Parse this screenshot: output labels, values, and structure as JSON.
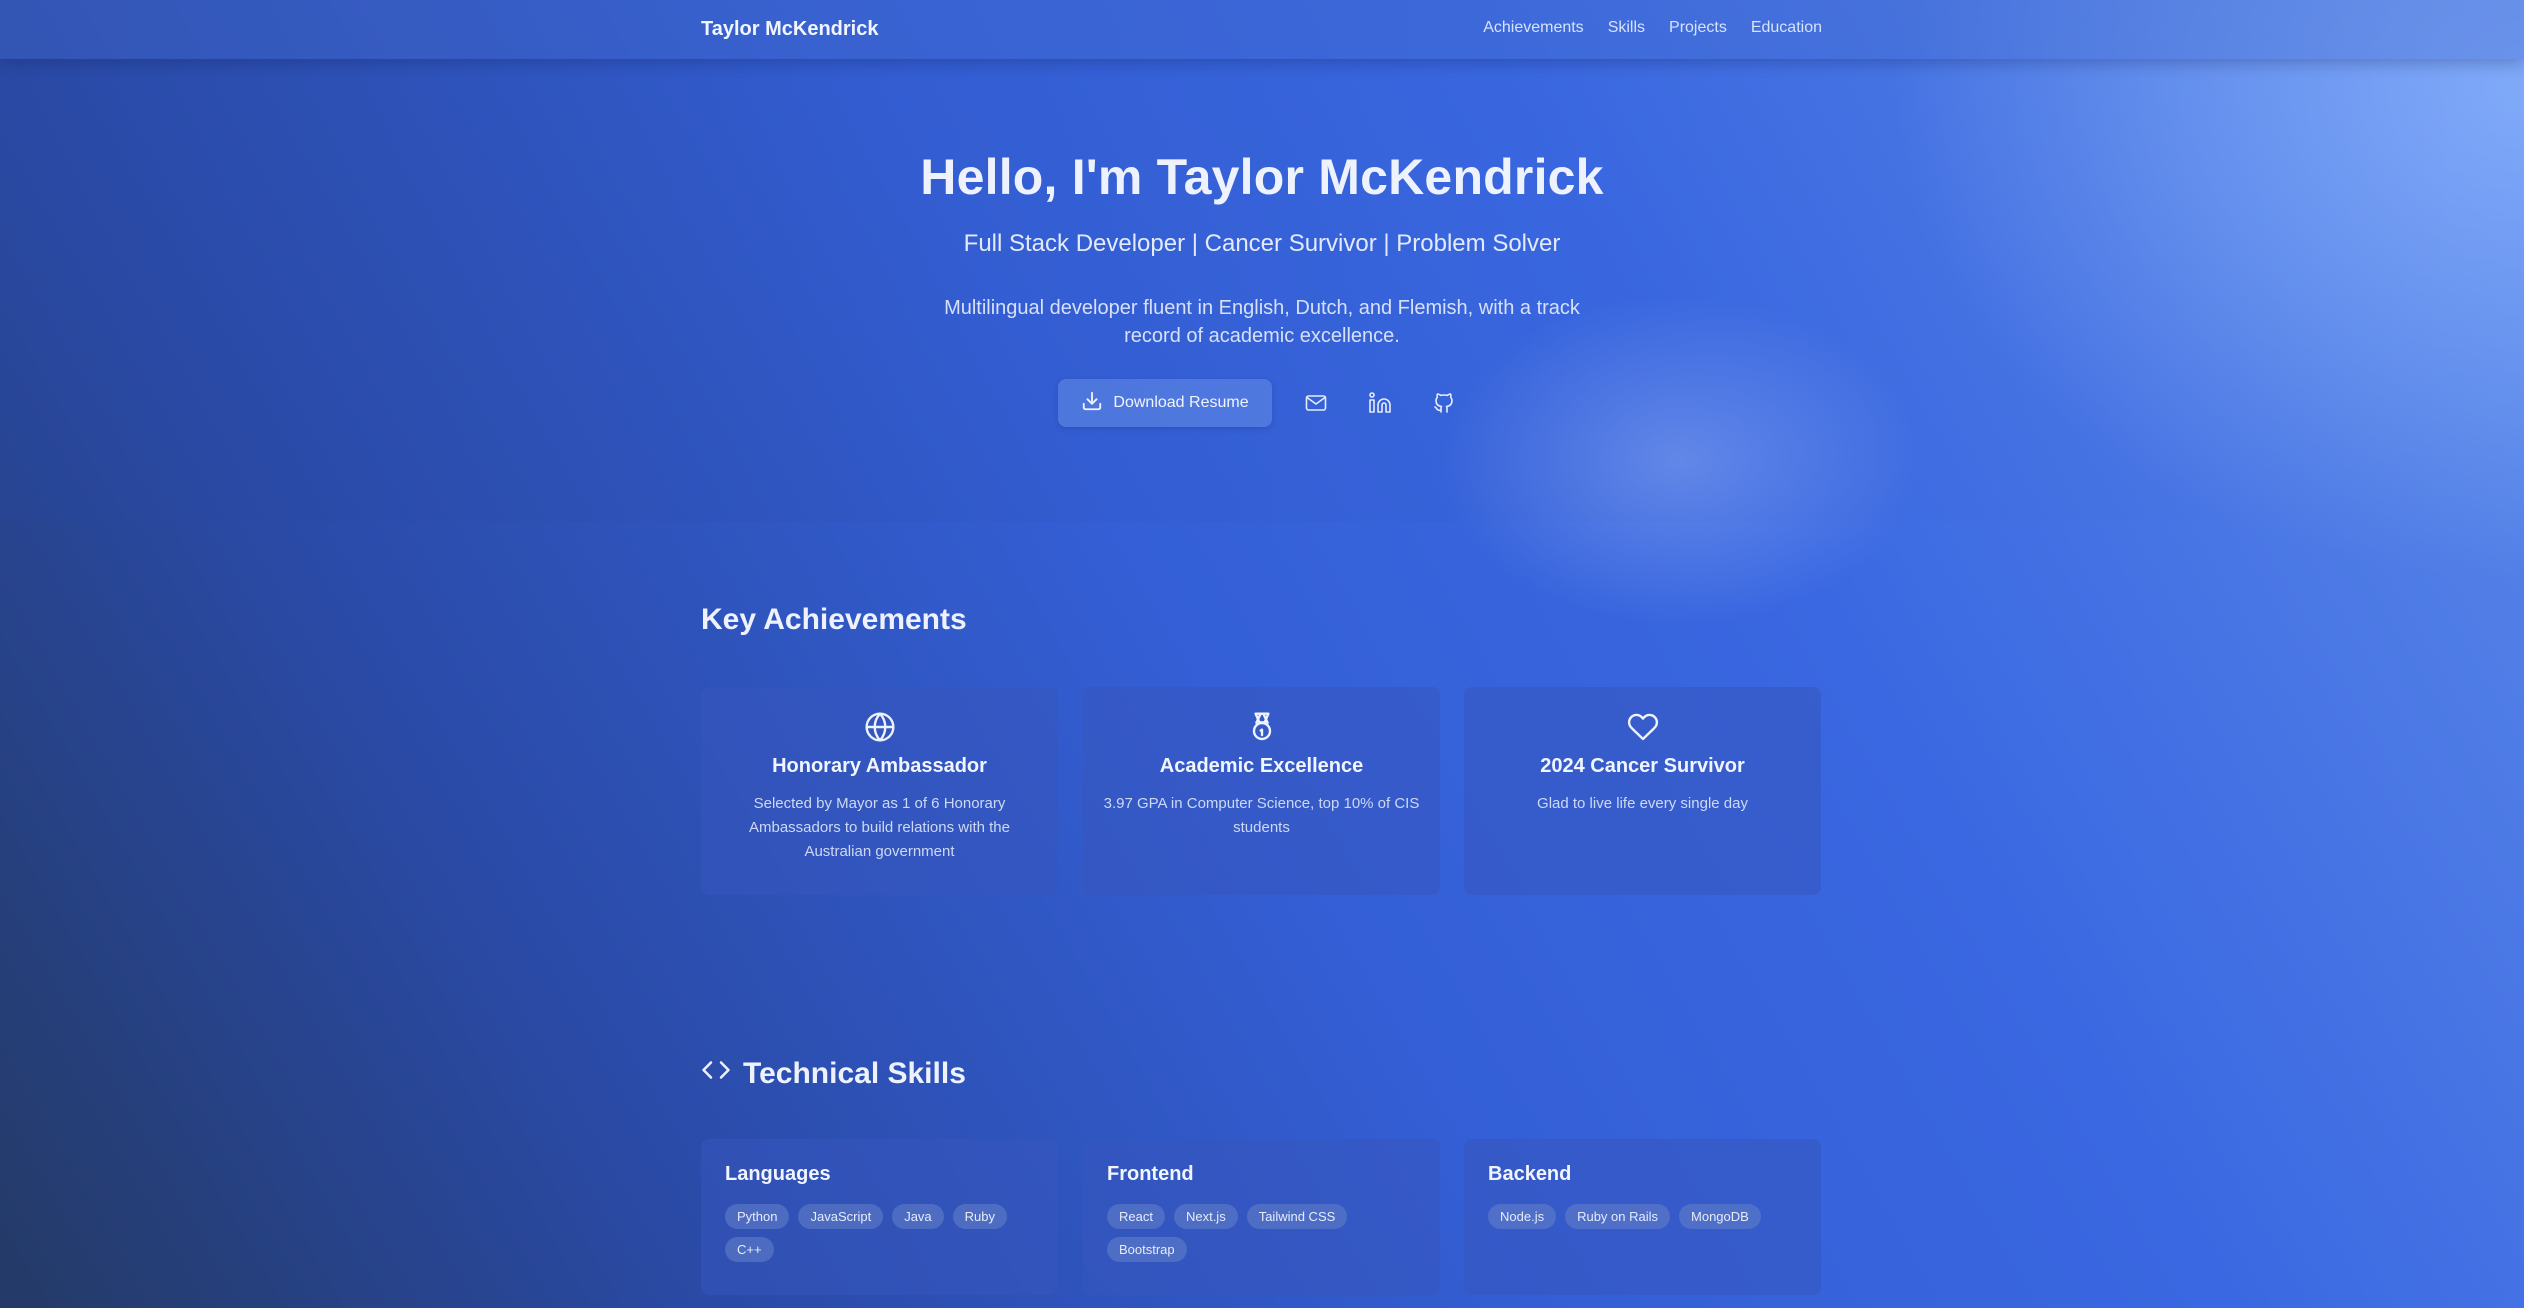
{
  "nav": {
    "brand": "Taylor McKendrick",
    "links": [
      "Achievements",
      "Skills",
      "Projects",
      "Education"
    ]
  },
  "hero": {
    "title": "Hello, I'm Taylor McKendrick",
    "subtitle": "Full Stack Developer | Cancer Survivor | Problem Solver",
    "description": "Multilingual developer fluent in English, Dutch, and Flemish, with a track record of academic excellence.",
    "resume_button": "Download Resume",
    "social_icons": [
      "mail-icon",
      "linkedin-icon",
      "github-icon"
    ]
  },
  "achievements": {
    "title": "Key Achievements",
    "items": [
      {
        "icon": "globe-icon",
        "title": "Honorary Ambassador",
        "text": "Selected by Mayor as 1 of 6 Honorary Ambassadors to build relations with the Australian government"
      },
      {
        "icon": "medal-icon",
        "title": "Academic Excellence",
        "text": "3.97 GPA in Computer Science, top 10% of CIS students"
      },
      {
        "icon": "heart-icon",
        "title": "2024 Cancer Survivor",
        "text": "Glad to live life every single day"
      }
    ]
  },
  "skills": {
    "title": "Technical Skills",
    "icon": "code-icon",
    "groups": [
      {
        "title": "Languages",
        "tags": [
          "Python",
          "JavaScript",
          "Java",
          "Ruby",
          "C++"
        ]
      },
      {
        "title": "Frontend",
        "tags": [
          "React",
          "Next.js",
          "Tailwind CSS",
          "Bootstrap"
        ]
      },
      {
        "title": "Backend",
        "tags": [
          "Node.js",
          "Ruby on Rails",
          "MongoDB"
        ]
      }
    ]
  }
}
